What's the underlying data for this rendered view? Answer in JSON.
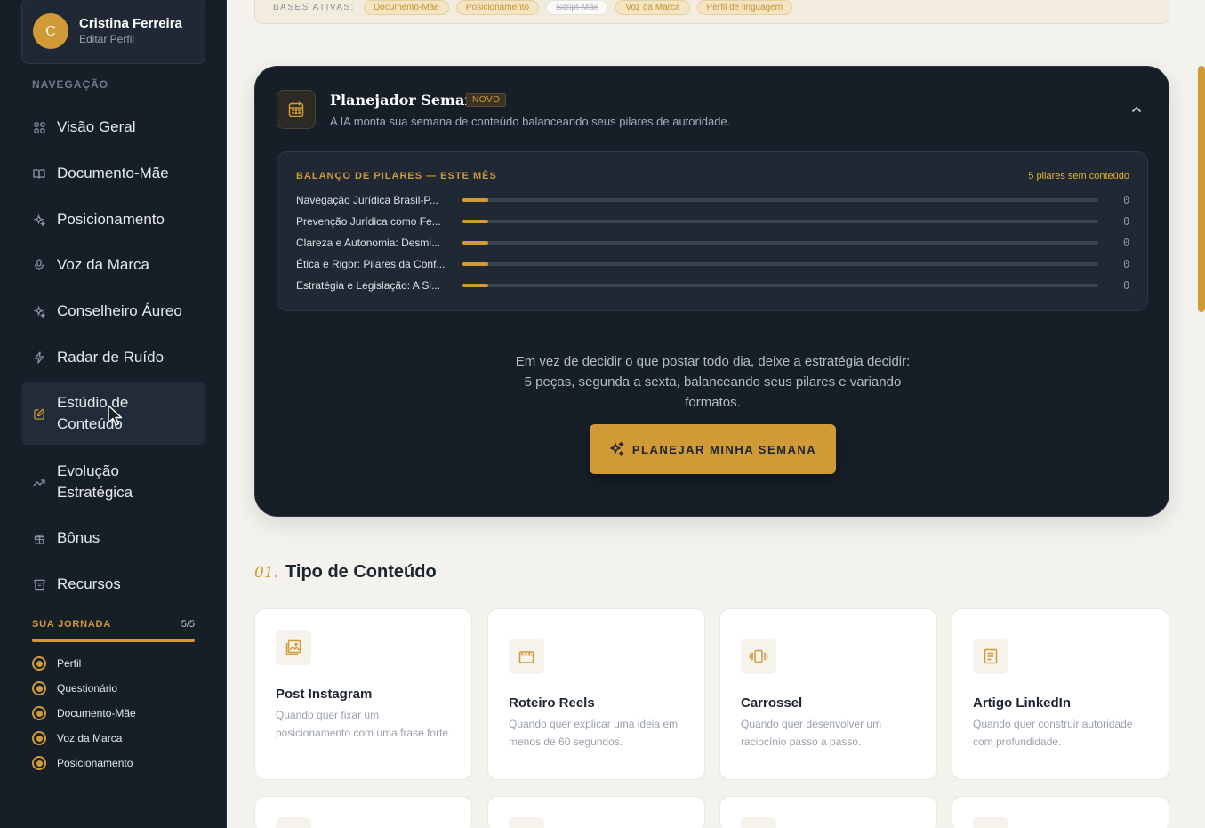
{
  "colors": {
    "accent": "#d09a36",
    "sidebar_bg": "#161e28",
    "page_bg": "#f4f2ec"
  },
  "profile": {
    "initial": "C",
    "name": "Cristina Ferreira",
    "edit_label": "Editar Perfil"
  },
  "nav": {
    "heading": "NAVEGAÇÃO",
    "items": [
      {
        "label": "Visão Geral",
        "icon": "grid-icon"
      },
      {
        "label": "Documento-Mãe",
        "icon": "book-icon"
      },
      {
        "label": "Posicionamento",
        "icon": "sparkle-icon"
      },
      {
        "label": "Voz da Marca",
        "icon": "microphone-icon"
      },
      {
        "label": "Conselheiro Áureo",
        "icon": "sparkle-icon"
      },
      {
        "label": "Radar de Ruído",
        "icon": "lightning-icon"
      },
      {
        "label": "Estúdio de Conteúdo",
        "icon": "pencil-square-icon",
        "active": true
      },
      {
        "label": "Evolução Estratégica",
        "icon": "trend-up-icon"
      },
      {
        "label": "Bônus",
        "icon": "gift-icon"
      },
      {
        "label": "Recursos",
        "icon": "archive-icon"
      }
    ]
  },
  "journey": {
    "title": "SUA JORNADA",
    "count": "5/5",
    "progress": 1.0,
    "steps": [
      "Perfil",
      "Questionário",
      "Documento-Mãe",
      "Voz da Marca",
      "Posicionamento"
    ]
  },
  "bases": {
    "label": "BASES ATIVAS:",
    "chips": [
      {
        "label": "Documento-Mãe",
        "active": true
      },
      {
        "label": "Posicionamento",
        "active": true
      },
      {
        "label": "Script-Mãe",
        "active": false
      },
      {
        "label": "Voz da Marca",
        "active": true
      },
      {
        "label": "Perfil de linguagem",
        "active": true
      }
    ]
  },
  "planner": {
    "title": "Planejador Semanal",
    "badge": "NOVO",
    "subtitle": "A IA monta sua semana de conteúdo balanceando seus pilares de autoridade.",
    "pillars_title": "BALANÇO DE PILARES — ESTE MÊS",
    "pillars_note": "5 pilares sem conteúdo",
    "pillars": [
      {
        "name": "Navegação Jurídica Brasil-P...",
        "value": "0"
      },
      {
        "name": "Prevenção Jurídica como Fe...",
        "value": "0"
      },
      {
        "name": "Clareza e Autonomia: Desmi...",
        "value": "0"
      },
      {
        "name": "Ética e Rigor: Pilares da Conf...",
        "value": "0"
      },
      {
        "name": "Estratégia e Legislação: A Si...",
        "value": "0"
      }
    ],
    "description_lines": [
      "Em vez de decidir o que postar todo dia, deixe a estratégia decidir:",
      "5 peças, segunda a sexta, balanceando seus pilares e variando",
      "formatos."
    ],
    "button_label": "PLANEJAR MINHA SEMANA"
  },
  "content_type": {
    "number": "01.",
    "title": "Tipo de Conteúdo",
    "cards": [
      {
        "title": "Post Instagram",
        "description": "Quando quer fixar um posicionamento com uma frase forte.",
        "icon": "image-icon"
      },
      {
        "title": "Roteiro Reels",
        "description": "Quando quer explicar uma ideia em menos de 60 segundos.",
        "icon": "clapperboard-icon"
      },
      {
        "title": "Carrossel",
        "description": "Quando quer desenvolver um raciocínio passo a passo.",
        "icon": "carousel-icon"
      },
      {
        "title": "Artigo LinkedIn",
        "description": "Quando quer construir autoridade com profundidade.",
        "icon": "article-icon"
      }
    ]
  }
}
